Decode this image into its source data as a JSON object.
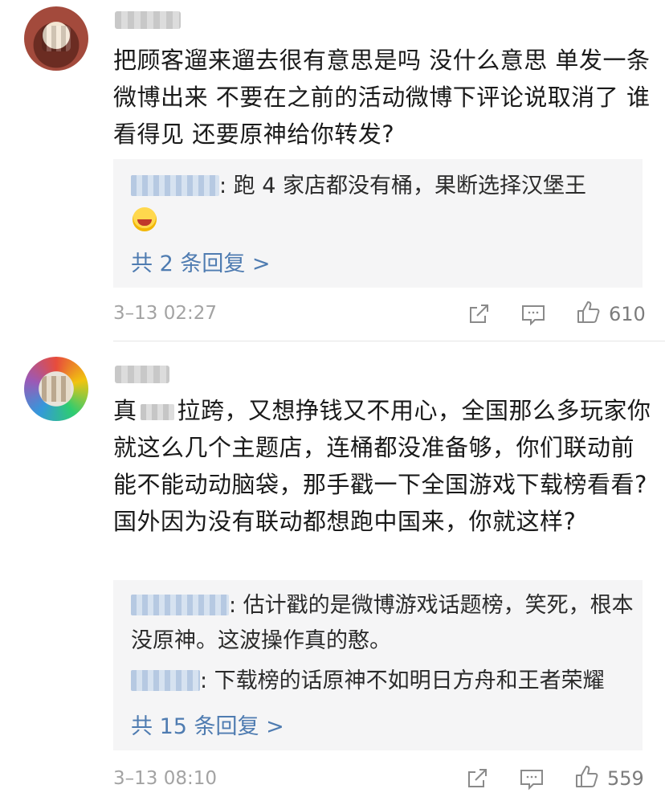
{
  "comments": [
    {
      "text": "把顾客遛来遛去很有意思是吗 没什么意思 单发一条微博出来 不要在之前的活动微博下评论说取消了 谁看得见  还要原神给你转发?",
      "replies": [
        {
          "text": ": 跑 4 家店都没有桶，果断选择汉堡王"
        }
      ],
      "more_replies": "共 2 条回复 >",
      "time": "3–13 02:27",
      "likes": "610"
    },
    {
      "text_before": "真",
      "text_after": "拉跨，又想挣钱又不用心，全国那么多玩家你就这么几个主题店，连桶都没准备够，你们联动前能不能动动脑袋，那手戳一下全国游戏下载榜看看? 国外因为没有联动都想跑中国来，你就这样?",
      "replies": [
        {
          "text": ": 估计戳的是微博游戏话题榜，笑死，根本没原神。这波操作真的憨。"
        },
        {
          "text": ": 下载榜的话原神不如明日方舟和王者荣耀"
        }
      ],
      "more_replies": "共 15 条回复 >",
      "time": "3–13 08:10",
      "likes": "559"
    }
  ],
  "icons": [
    "share-icon",
    "comment-icon",
    "like-icon",
    "emoji-laugh-cry-icon"
  ],
  "colors": {
    "link": "#4f7cb1",
    "meta": "#a3a3a3",
    "reply_bg": "#f5f5f6"
  }
}
